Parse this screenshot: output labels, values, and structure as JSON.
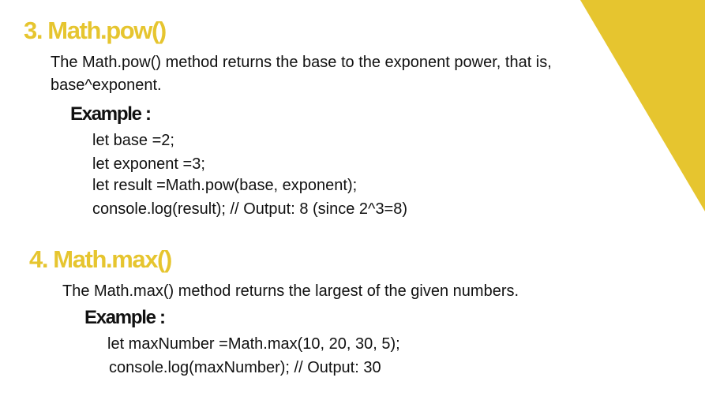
{
  "theme": {
    "accent": "#e6c52f",
    "text": "#111111",
    "background": "#ffffff"
  },
  "sections": [
    {
      "heading": "3. Math.pow()",
      "description_lines": [
        "The Math.pow() method returns the base to the exponent power, that is,",
        "base^exponent."
      ],
      "example_label": "Example :",
      "code_lines": [
        "let base =2;",
        "let exponent =3;",
        "let result =Math.pow(base, exponent);",
        "console.log(result);  // Output: 8 (since 2^3=8)"
      ]
    },
    {
      "heading": "4. Math.max()",
      "description_lines": [
        "The Math.max() method returns the largest of the given numbers."
      ],
      "example_label": "Example :",
      "code_lines": [
        "let maxNumber =Math.max(10, 20, 30, 5);",
        "console.log(maxNumber);  // Output: 30"
      ]
    }
  ]
}
